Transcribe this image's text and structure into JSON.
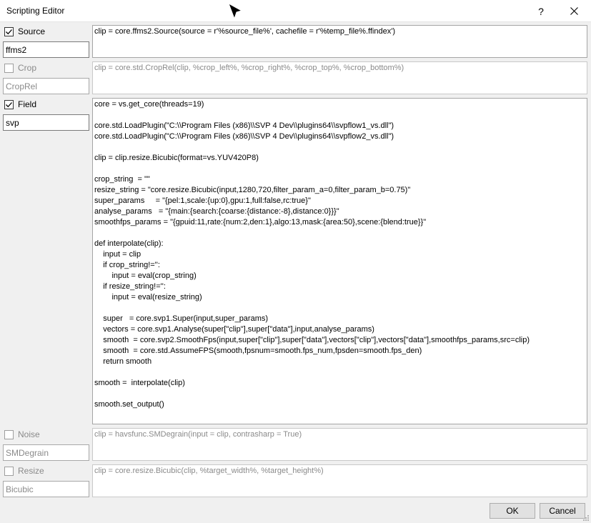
{
  "window": {
    "title": "Scripting Editor",
    "help_label": "?",
    "close_label": "✕"
  },
  "sections": [
    {
      "key": "source",
      "label": "Source",
      "checked": true,
      "name": "ffms2",
      "code": "clip = core.ffms2.Source(source = r'%source_file%', cachefile = r'%temp_file%.ffindex')"
    },
    {
      "key": "crop",
      "label": "Crop",
      "checked": false,
      "name": "CropRel",
      "code": "clip = core.std.CropRel(clip, %crop_left%, %crop_right%, %crop_top%, %crop_bottom%)"
    },
    {
      "key": "field",
      "label": "Field",
      "checked": true,
      "name": "svp",
      "code": "core = vs.get_core(threads=19)\n\ncore.std.LoadPlugin(\"C:\\\\Program Files (x86)\\\\SVP 4 Dev\\\\plugins64\\\\svpflow1_vs.dll\")\ncore.std.LoadPlugin(\"C:\\\\Program Files (x86)\\\\SVP 4 Dev\\\\plugins64\\\\svpflow2_vs.dll\")\n\nclip = clip.resize.Bicubic(format=vs.YUV420P8)\n\ncrop_string  = \"\"\nresize_string = \"core.resize.Bicubic(input,1280,720,filter_param_a=0,filter_param_b=0.75)\"\nsuper_params     = \"{pel:1,scale:{up:0},gpu:1,full:false,rc:true}\"\nanalyse_params   = \"{main:{search:{coarse:{distance:-8},distance:0}}}\"\nsmoothfps_params = \"{gpuid:11,rate:{num:2,den:1},algo:13,mask:{area:50},scene:{blend:true}}\"\n\ndef interpolate(clip):\n    input = clip\n    if crop_string!='':\n        input = eval(crop_string)\n    if resize_string!='':\n        input = eval(resize_string)\n\n    super   = core.svp1.Super(input,super_params)\n    vectors = core.svp1.Analyse(super[\"clip\"],super[\"data\"],input,analyse_params)\n    smooth  = core.svp2.SmoothFps(input,super[\"clip\"],super[\"data\"],vectors[\"clip\"],vectors[\"data\"],smoothfps_params,src=clip)\n    smooth  = core.std.AssumeFPS(smooth,fpsnum=smooth.fps_num,fpsden=smooth.fps_den)\n    return smooth\n\nsmooth =  interpolate(clip)\n\nsmooth.set_output()"
    },
    {
      "key": "noise",
      "label": "Noise",
      "checked": false,
      "name": "SMDegrain",
      "code": "clip = havsfunc.SMDegrain(input = clip, contrasharp = True)"
    },
    {
      "key": "resize",
      "label": "Resize",
      "checked": false,
      "name": "Bicubic",
      "code": "clip = core.resize.Bicubic(clip, %target_width%, %target_height%)"
    }
  ],
  "footer": {
    "ok_label": "OK",
    "cancel_label": "Cancel"
  }
}
